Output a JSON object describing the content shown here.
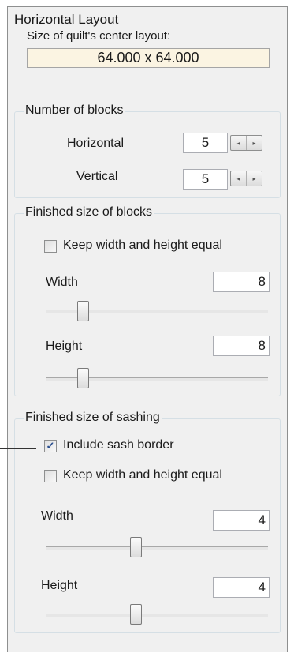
{
  "panel": {
    "title": "Horizontal Layout"
  },
  "center_layout": {
    "label": "Size of quilt's center layout:",
    "value": "64.000 x 64.000"
  },
  "blocks_count": {
    "title": "Number of blocks",
    "horizontal_label": "Horizontal",
    "horizontal_value": "5",
    "vertical_label": "Vertical",
    "vertical_value": "5",
    "spin_left": "◂",
    "spin_right": "▸"
  },
  "block_size": {
    "title": "Finished size of blocks",
    "keep_equal_label": "Keep width and height equal",
    "keep_equal_checked": false,
    "width_label": "Width",
    "width_value": "8",
    "width_slider_fraction": 0.15,
    "height_label": "Height",
    "height_value": "8",
    "height_slider_fraction": 0.15
  },
  "sashing": {
    "title": "Finished size of sashing",
    "include_border_label": "Include sash border",
    "include_border_checked": true,
    "check_mark": "✓",
    "keep_equal_label": "Keep width and height equal",
    "keep_equal_checked": false,
    "width_label": "Width",
    "width_value": "4",
    "width_slider_fraction": 0.4,
    "height_label": "Height",
    "height_value": "4",
    "height_slider_fraction": 0.4
  }
}
